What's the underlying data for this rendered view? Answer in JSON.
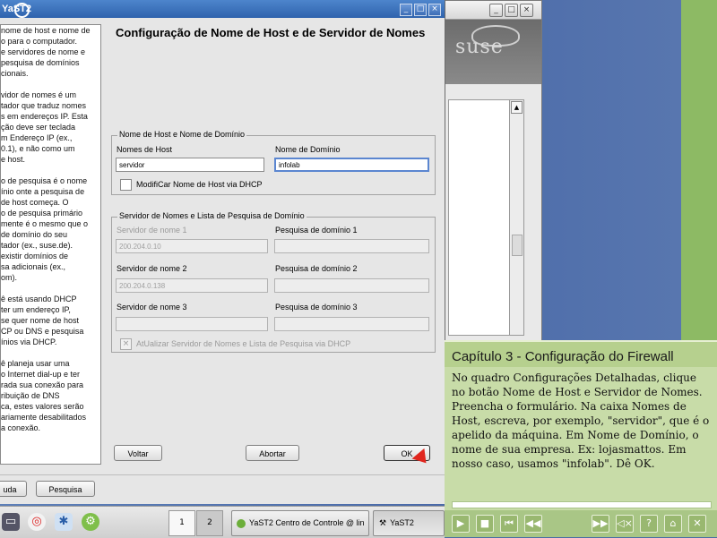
{
  "dialog": {
    "window_title": "YaST2",
    "page_title": "Configuração de Nome de Host e de Servidor de Nomes",
    "help_paragraphs": [
      "nome de host e nome de\no para o computador.\ne servidores de nome e\n pesquisa de domínios\ncionais.",
      "vidor de nomes é um\ntador que traduz nomes\ns em endereços IP. Esta\nção deve ser teclada\nm Endereço IP (ex.,\n0.1), e não como um\ne host.",
      "o de pesquisa é o nome\nínio onte a pesquisa de\nde host começa. O\no de pesquisa primário\nmente é o mesmo que o\nde domínio do seu\ntador (ex., suse.de).\n existir domínios de\nsa adicionais (ex.,\nom).",
      "ê está usando DHCP\nter um endereço IP,\nse quer nome de host\nCP ou DNS e pesquisa\nínios via DHCP.",
      "ê planeja usar uma\no Internet dial-up e ter\nrada sua conexão para\nribuição de DNS\nca, estes valores serão\nariamente desabilitados\n a conexão."
    ],
    "hostname_group": {
      "legend": "Nome de Host e Nome de Domínio",
      "hostname_label": "Nomes de Host",
      "hostname_value": "servidor",
      "domain_label": "Nome de Domínio",
      "domain_value": "infolab",
      "dhcp_checkbox_label": "ModifiCar Nome de Host via DHCP"
    },
    "dns_group": {
      "legend": "Servidor de Nomes e Lista de Pesquisa de Domínio",
      "ns1_label": "Servidor de nome 1",
      "ns1_value": "200.204.0.10",
      "ns2_label": "Servidor de nome 2",
      "ns2_value": "200.204.0.138",
      "ns3_label": "Servidor de nome 3",
      "ns3_value": "",
      "search1_label": "Pesquisa de domínio 1",
      "search2_label": "Pesquisa de domínio 2",
      "search3_label": "Pesquisa de domínio 3",
      "dhcp_update_label": "AtUalizar Servidor de Nomes e Lista de Pesquisa via DHCP"
    },
    "buttons": {
      "back": "Voltar",
      "abort": "Abortar",
      "ok": "OK"
    },
    "lower_buttons": {
      "help": "uda",
      "search": "Pesquisa"
    }
  },
  "control_center": {
    "logo": "suse"
  },
  "tutorial": {
    "title": "Capítulo 3 - Configuração do Firewall",
    "body": "No quadro Configurações Detalhadas, clique no botão Nome de Host e Servidor de Nomes. Preencha o formulário. Na caixa Nomes de Host, escreva, por exemplo, \"servidor\", que é o apelido da máquina. Em Nome de Domínio, o nome de sua empresa. Ex: lojasmattos. Em nosso caso, usamos \"infolab\". Dê OK."
  },
  "taskbar": {
    "pager": [
      "1",
      "2"
    ],
    "tasks": [
      "YaST2 Centro de Controle @ lin",
      "YaST2"
    ]
  },
  "colors": {
    "title_bar": "#2f63ad",
    "tutorial_bg": "#c8dca8",
    "ok_arrow": "#e0261e"
  }
}
